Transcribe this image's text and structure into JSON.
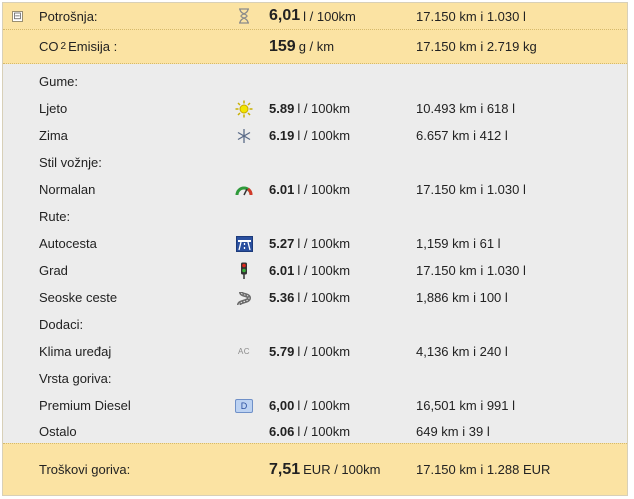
{
  "consumption": {
    "toggle": "⊟",
    "label": "Potrošnja:",
    "value": "6,01",
    "unit": "l / 100km",
    "distance": "17.150 km i 1.030 l"
  },
  "co2": {
    "label_pre": "CO",
    "label_sub": "2",
    "label_post": "Emisija :",
    "value": "159",
    "unit": "g / km",
    "distance": "17.150 km i 2.719 kg"
  },
  "sections": {
    "tires": "Gume:",
    "style": "Stil vožnje:",
    "routes": "Rute:",
    "extras": "Dodaci:",
    "fuel_type": "Vrsta goriva:"
  },
  "rows": {
    "summer": {
      "label": "Ljeto",
      "value": "5.89",
      "unit": "l / 100km",
      "distance": "10.493 km i 618 l"
    },
    "winter": {
      "label": "Zima",
      "value": "6.19",
      "unit": "l / 100km",
      "distance": "6.657 km i 412 l"
    },
    "normal": {
      "label": "Normalan",
      "value": "6.01",
      "unit": "l / 100km",
      "distance": "17.150 km i 1.030 l"
    },
    "highway": {
      "label": "Autocesta",
      "value": "5.27",
      "unit": "l / 100km",
      "distance": "1,159 km i 61 l"
    },
    "city": {
      "label": "Grad",
      "value": "6.01",
      "unit": "l / 100km",
      "distance": "17.150 km i 1.030 l"
    },
    "country": {
      "label": "Seoske ceste",
      "value": "5.36",
      "unit": "l / 100km",
      "distance": "1,886 km i 100 l"
    },
    "ac": {
      "label": "Klima uređaj",
      "icon_text": "AC",
      "value": "5.79",
      "unit": "l / 100km",
      "distance": "4,136 km i 240 l"
    },
    "diesel": {
      "label": "Premium Diesel",
      "icon_text": "D",
      "value": "6,00",
      "unit": "l / 100km",
      "distance": "16,501 km i 991 l"
    },
    "other": {
      "label": "Ostalo",
      "value": "6.06",
      "unit": "l / 100km",
      "distance": "649 km i 39 l"
    }
  },
  "costs": {
    "label": "Troškovi goriva:",
    "value": "7,51",
    "unit": "EUR / 100km",
    "distance": "17.150 km i 1.288 EUR"
  },
  "colors": {
    "highlight": "#fbe3a3",
    "section_bg": "#ececec",
    "accent_blue": "#2a4f9e"
  }
}
